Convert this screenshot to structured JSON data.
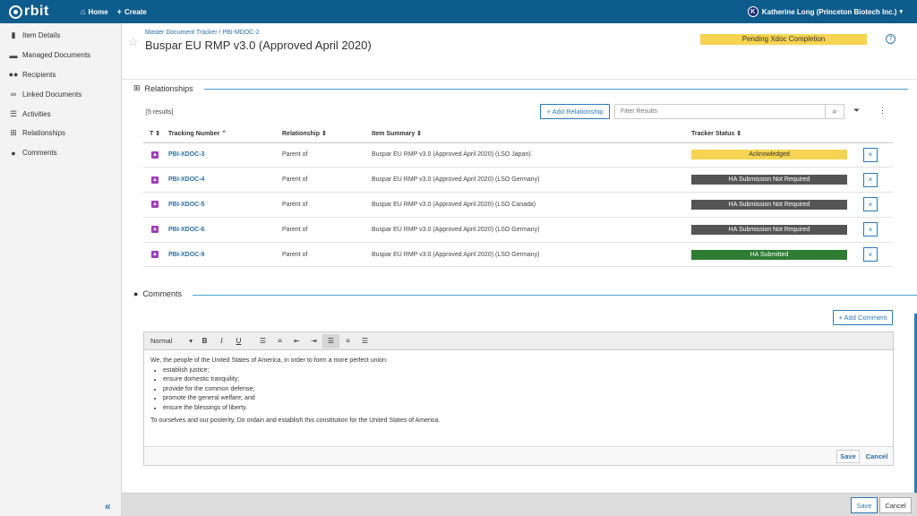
{
  "app": {
    "logo_text": "rbit",
    "nav": {
      "home": "Home",
      "create": "Create"
    },
    "user": {
      "initial": "K",
      "name": "Katherine Long (Princeton Biotech Inc.)"
    }
  },
  "sidebar": {
    "items": [
      {
        "label": "Item Details",
        "icon": "info-icon"
      },
      {
        "label": "Managed Documents",
        "icon": "folder-icon"
      },
      {
        "label": "Recipients",
        "icon": "users-icon"
      },
      {
        "label": "Linked Documents",
        "icon": "link-icon"
      },
      {
        "label": "Activities",
        "icon": "list-icon"
      },
      {
        "label": "Relationships",
        "icon": "sitemap-icon"
      },
      {
        "label": "Comments",
        "icon": "comments-icon"
      }
    ],
    "collapse": "«"
  },
  "header": {
    "breadcrumb": "Master Document Tracker / PBI-MDOC-2",
    "title": "Buspar EU RMP v3.0 (Approved April 2020)",
    "status": "Pending Xdoc Completion",
    "status_color": "#f6d451"
  },
  "relationships": {
    "title": "Relationships",
    "results_text": "[5 results]",
    "add_button": "+ Add Relationship",
    "filter_placeholder": "Filter Results",
    "columns": [
      "T ⇕",
      "Tracking Number ⌃",
      "Relationship ⇕",
      "Item Summary ⇕",
      "Tracker Status ⇕"
    ],
    "rows": [
      {
        "tracking": "PBI-XDOC-3",
        "relationship": "Parent of",
        "summary": "Buspar EU RMP v3.0 (Approved April 2020) (LSO Japan)",
        "status": "Acknowledged",
        "status_bg": "#f6d451",
        "status_fg": "#333333"
      },
      {
        "tracking": "PBI-XDOC-4",
        "relationship": "Parent of",
        "summary": "Buspar EU RMP v3.0 (Approved April 2020) (LSO Germany)",
        "status": "HA Submission Not Required",
        "status_bg": "#555555",
        "status_fg": "#ffffff"
      },
      {
        "tracking": "PBI-XDOC-5",
        "relationship": "Parent of",
        "summary": "Buspar EU RMP v3.0 (Approved April 2020) (LSO Canada)",
        "status": "HA Submission Not Required",
        "status_bg": "#555555",
        "status_fg": "#ffffff"
      },
      {
        "tracking": "PBI-XDOC-6",
        "relationship": "Parent of",
        "summary": "Buspar EU RMP v3.0 (Approved April 2020) (LSO Germany)",
        "status": "HA Submission Not Required",
        "status_bg": "#555555",
        "status_fg": "#ffffff"
      },
      {
        "tracking": "PBI-XDOC-9",
        "relationship": "Parent of",
        "summary": "Buspar EU RMP v3.0 (Approved April 2020) (LSO Germany)",
        "status": "HA Submitted",
        "status_bg": "#2e7d32",
        "status_fg": "#ffffff"
      }
    ]
  },
  "comments": {
    "title": "Comments",
    "add_button": "+ Add Comment",
    "format_select": "Normal",
    "intro": "We, the people of the United States of America, in order to form a more perfect union:",
    "bullets": [
      "establish justice;",
      "ensure domestic tranquility;",
      "provide for the common defense;",
      "promote the general welfare; and",
      "ensure the blessings of liberty."
    ],
    "outro": "To ourselves and our posterity, Do ordain and establish this constitution for the United States of America.",
    "save": "Save",
    "cancel": "Cancel"
  },
  "footer": {
    "save": "Save",
    "cancel": "Cancel"
  }
}
